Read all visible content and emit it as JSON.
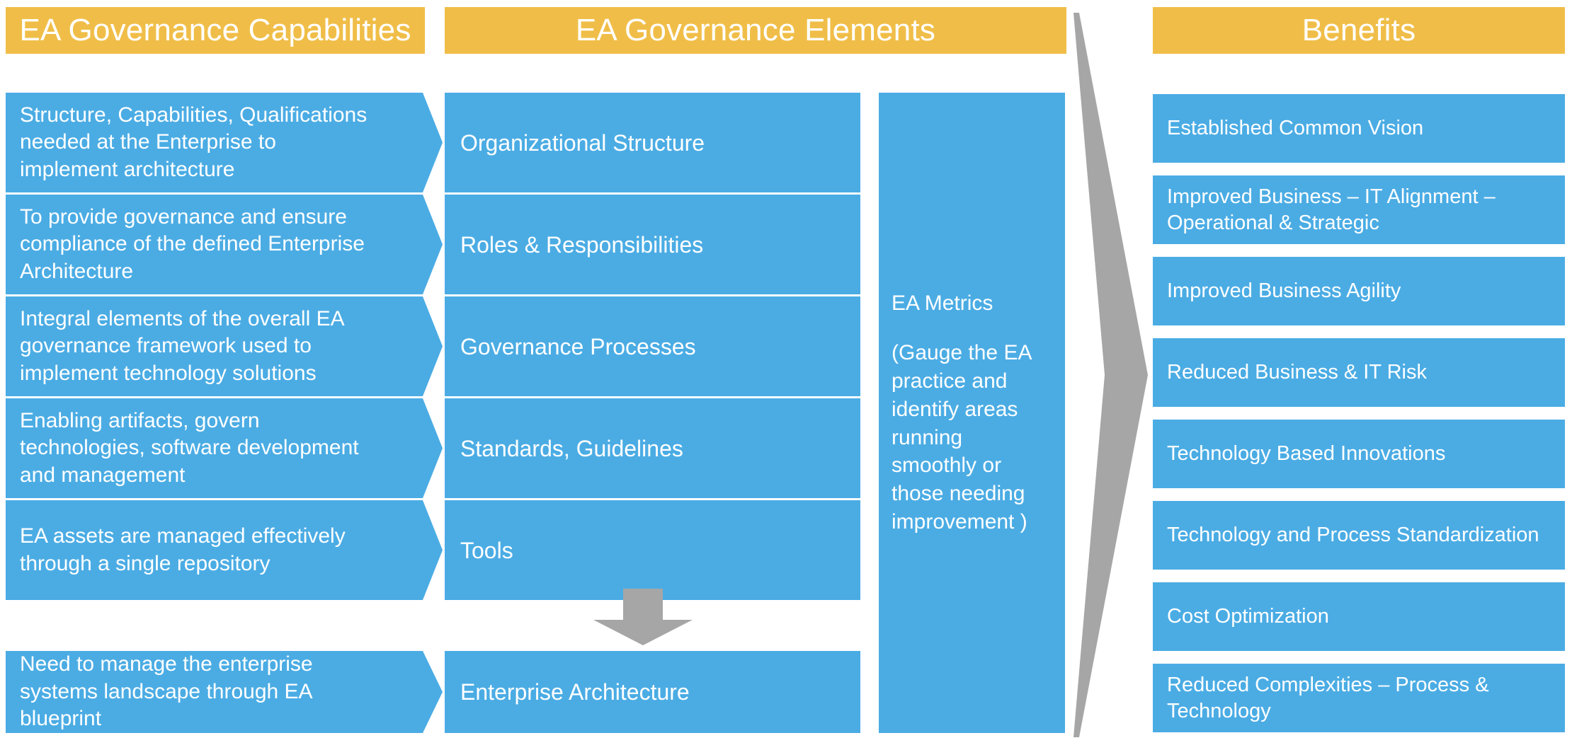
{
  "colors": {
    "header_gold": "#F0BE48",
    "box_blue": "#4BACE4",
    "arrow_gray": "#A6A6A6",
    "text_white": "#FFFFFF",
    "background": "#FFFFFF"
  },
  "columns": {
    "capabilities": {
      "header": "EA Governance Capabilities",
      "items": [
        "Structure, Capabilities, Qualifications needed at the Enterprise to implement architecture",
        "To provide governance and ensure compliance of the defined Enterprise Architecture",
        "Integral elements of the overall EA governance framework used to implement technology solutions",
        "Enabling artifacts, govern technologies, software development and management",
        "EA assets are managed effectively through a single repository",
        "Need to manage the enterprise systems landscape through EA blueprint"
      ]
    },
    "elements": {
      "header": "EA Governance Elements",
      "items": [
        "Organizational Structure",
        "Roles & Responsibilities",
        "Governance Processes",
        "Standards, Guidelines",
        "Tools",
        "Enterprise Architecture"
      ]
    },
    "metrics": {
      "title": "EA Metrics",
      "description": "(Gauge the EA practice and identify areas running smoothly or those needing improvement )"
    },
    "benefits": {
      "header": "Benefits",
      "items": [
        "Established Common Vision",
        "Improved Business – IT Alignment – Operational & Strategic",
        "Improved Business Agility",
        "Reduced Business & IT Risk",
        "Technology Based Innovations",
        "Technology and Process Standardization",
        "Cost Optimization",
        "Reduced Complexities – Process & Technology"
      ]
    }
  },
  "connectors": {
    "down_arrow": "down-arrow-icon",
    "big_right_arrow": "right-arrow-icon"
  }
}
